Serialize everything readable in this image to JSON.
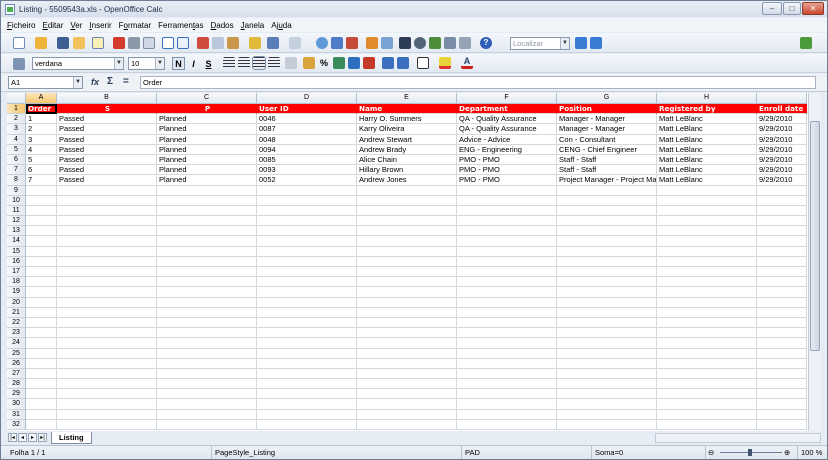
{
  "window": {
    "title": "Listing - 5509543a.xls - OpenOffice Calc",
    "minimize": "–",
    "maximize": "□",
    "close": "✕"
  },
  "menu": [
    {
      "pre": "",
      "u": "F",
      "post": "icheiro"
    },
    {
      "pre": "",
      "u": "E",
      "post": "ditar"
    },
    {
      "pre": "",
      "u": "V",
      "post": "er"
    },
    {
      "pre": "",
      "u": "I",
      "post": "nserir"
    },
    {
      "pre": "F",
      "u": "o",
      "post": "rmatar"
    },
    {
      "pre": "Ferramen",
      "u": "t",
      "post": "as"
    },
    {
      "pre": "",
      "u": "D",
      "post": "ados"
    },
    {
      "pre": "",
      "u": "J",
      "post": "anela"
    },
    {
      "pre": "Aj",
      "u": "u",
      "post": "da"
    }
  ],
  "toolbar": {
    "search_placeholder": "Localizar"
  },
  "format": {
    "font": "verdana",
    "size": "10",
    "bold": "N",
    "italic": "I",
    "underline": "S"
  },
  "formula": {
    "cell_ref": "A1",
    "fx": "fx",
    "sigma": "Σ",
    "equals": "=",
    "value": "Order"
  },
  "columns": [
    "A",
    "B",
    "C",
    "D",
    "E",
    "F",
    "G",
    "H",
    ""
  ],
  "headers": [
    "Order",
    "S",
    "P",
    "User ID",
    "Name",
    "Department",
    "Position",
    "Registered by",
    "Enroll date"
  ],
  "data": [
    [
      "1",
      "Passed",
      "Planned",
      "0046",
      "Harry O. Summers",
      "QA - Quality Assurance",
      "Manager - Manager",
      "Matt LeBlanc",
      "9/29/2010"
    ],
    [
      "2",
      "Passed",
      "Planned",
      "0087",
      "Karry Oliveira",
      "QA - Quality Assurance",
      "Manager - Manager",
      "Matt LeBlanc",
      "9/29/2010"
    ],
    [
      "3",
      "Passed",
      "Planned",
      "0048",
      "Andrew Stewart",
      "Advice - Advice",
      "Con - Consultant",
      "Matt LeBlanc",
      "9/29/2010"
    ],
    [
      "4",
      "Passed",
      "Planned",
      "0094",
      "Andrew Brady",
      "ENG - Engineering",
      "CENG - Chief Engineer",
      "Matt LeBlanc",
      "9/29/2010"
    ],
    [
      "5",
      "Passed",
      "Planned",
      "0085",
      "Alice Chain",
      "PMO - PMO",
      "Staff - Staff",
      "Matt LeBlanc",
      "9/29/2010"
    ],
    [
      "6",
      "Passed",
      "Planned",
      "0093",
      "Hillary Brown",
      "PMO - PMO",
      "Staff - Staff",
      "Matt LeBlanc",
      "9/29/2010"
    ],
    [
      "7",
      "Passed",
      "Planned",
      "0052",
      "Andrew Jones",
      "PMO - PMO",
      "Project Manager - Project Ma",
      "Matt LeBlanc",
      "9/29/2010"
    ]
  ],
  "row_numbers": [
    "1",
    "2",
    "3",
    "4",
    "5",
    "6",
    "7",
    "8",
    "9",
    "10",
    "11",
    "12",
    "13",
    "14",
    "15",
    "16",
    "17",
    "18",
    "19",
    "20",
    "21",
    "22",
    "23",
    "24",
    "25",
    "26",
    "27",
    "28",
    "29",
    "30",
    "31",
    "32"
  ],
  "sheet_tab": "Listing",
  "status": {
    "sheet": "Folha 1 / 1",
    "page_style": "PageStyle_Listing",
    "mode": "PAD",
    "sum": "Soma=0",
    "zoom": "100 %"
  },
  "colors": {
    "header_fill": "#ff0000",
    "header_text": "#ffffff",
    "selection": "#f5c56f"
  }
}
